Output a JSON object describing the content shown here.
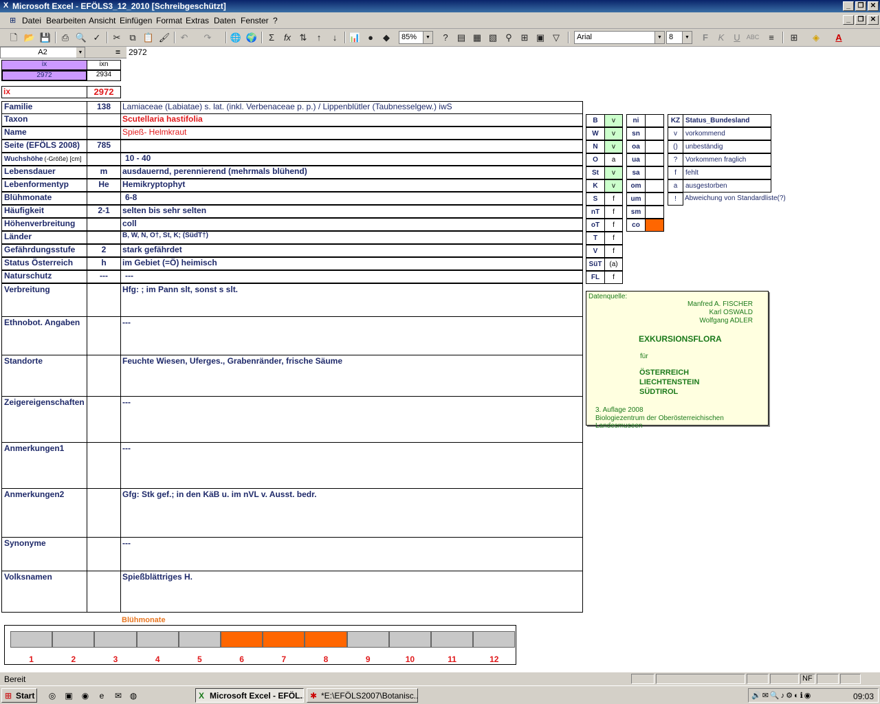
{
  "window": {
    "title": "Microsoft Excel - EFÖLS3_12_2010  [Schreibgeschützt]"
  },
  "menu": [
    "Datei",
    "Bearbeiten",
    "Ansicht",
    "Einfügen",
    "Format",
    "Extras",
    "Daten",
    "Fenster",
    "?"
  ],
  "toolbar": {
    "zoom": "85%",
    "font": "Arial",
    "size": "8"
  },
  "formula": {
    "cellref": "A2",
    "eq": "=",
    "value": "2972"
  },
  "top": {
    "ix_header": "ix",
    "ixn_header": "ixn",
    "ix_val": "2972",
    "ixn_val": "2934",
    "ix_label": "ix",
    "ix_big": "2972"
  },
  "rows": [
    {
      "label": "Familie",
      "mid": "138",
      "value": "Lamiaceae (Labiatae) s. lat. (inkl. Verbenaceae p. p.)  /  Lippenblütler (Taubnesselgew.) iwS"
    },
    {
      "label": "Taxon",
      "mid": "",
      "value": "Scutellaria hastifolia"
    },
    {
      "label": "Name",
      "mid": "",
      "value": "Spieß- Helmkraut"
    },
    {
      "label": "Seite (EFÖLS 2008)",
      "mid": "785",
      "value": ""
    },
    {
      "label": "Wuchshöhe",
      "label_small": "(-Größe) [cm]",
      "mid": "",
      "value": "10 - 40"
    },
    {
      "label": "Lebensdauer",
      "mid": "m",
      "value": "ausdauernd, perennierend (mehrmals blühend)"
    },
    {
      "label": "Lebenformentyp",
      "mid": "He",
      "value": "Hemikryptophyt"
    },
    {
      "label": "Blühmonate",
      "mid": "",
      "value": "6-8"
    },
    {
      "label": "Häufigkeit",
      "mid": "2-1",
      "value": "selten bis sehr selten"
    },
    {
      "label": "Höhenverbreitung",
      "mid": "",
      "value": "coll"
    },
    {
      "label": "Länder",
      "mid": "",
      "value": "B, W, N, O†, St, K; (SüdT†)"
    },
    {
      "label": "Gefährdungsstufe",
      "mid": "2",
      "value": "stark gefährdet"
    },
    {
      "label": "Status Österreich",
      "mid": "h",
      "value": "im Gebiet (=Ö) heimisch"
    },
    {
      "label": "Naturschutz",
      "mid": "---",
      "value": "---"
    }
  ],
  "big_rows": [
    {
      "label": "Verbreitung",
      "value": "Hfg: ; im Pann slt, sonst s slt."
    },
    {
      "label": "Ethnobot. Angaben",
      "value": "---"
    },
    {
      "label": "Standorte",
      "value": "Feuchte Wiesen, Uferges., Grabenränder, frische Säume"
    },
    {
      "label": "Zeigereigenschaften",
      "value": "---"
    },
    {
      "label": "Anmerkungen1",
      "value": "---"
    },
    {
      "label": "Anmerkungen2",
      "value": "Gfg:  Stk gef.; in den KäB u. im nVL v. Ausst. bedr."
    },
    {
      "label": "Synonyme",
      "value": "---"
    },
    {
      "label": "Volksnamen",
      "value": "Spießblättriges H."
    }
  ],
  "states": [
    {
      "k": "B",
      "v": "v"
    },
    {
      "k": "W",
      "v": "v"
    },
    {
      "k": "N",
      "v": "v"
    },
    {
      "k": "O",
      "v": "a"
    },
    {
      "k": "St",
      "v": "v"
    },
    {
      "k": "K",
      "v": "v"
    },
    {
      "k": "S",
      "v": "f"
    },
    {
      "k": "nT",
      "v": "f"
    },
    {
      "k": "oT",
      "v": "f"
    },
    {
      "k": "T",
      "v": "f"
    },
    {
      "k": "V",
      "v": "f"
    },
    {
      "k": "SüT",
      "v": "(a)"
    },
    {
      "k": "FL",
      "v": "f"
    }
  ],
  "zones": [
    {
      "k": "ni",
      "v": ""
    },
    {
      "k": "sn",
      "v": ""
    },
    {
      "k": "oa",
      "v": ""
    },
    {
      "k": "ua",
      "v": ""
    },
    {
      "k": "sa",
      "v": ""
    },
    {
      "k": "om",
      "v": ""
    },
    {
      "k": "um",
      "v": ""
    },
    {
      "k": "sm",
      "v": ""
    },
    {
      "k": "co",
      "v": ""
    }
  ],
  "legend": [
    {
      "k": "KZ",
      "v": "Status_Bundesland"
    },
    {
      "k": "v",
      "v": "vorkommend"
    },
    {
      "k": "()",
      "v": "unbeständig"
    },
    {
      "k": "?",
      "v": "Vorkommen fraglich"
    },
    {
      "k": "f",
      "v": "fehlt"
    },
    {
      "k": "a",
      "v": "ausgestorben"
    },
    {
      "k": "!",
      "v": "Abweichung von Standardliste(?)"
    }
  ],
  "source": {
    "head": "Datenquelle:",
    "authors": [
      "Manfred A. FISCHER",
      "Karl OSWALD",
      "Wolfgang ADLER"
    ],
    "title": "EXKURSIONSFLORA",
    "fuer": "für",
    "regions": [
      "ÖSTERREICH",
      "LIECHTENSTEIN",
      "SÜDTIROL"
    ],
    "edition": "3. Auflage 2008",
    "publisher": "Biologiezentrum der Oberösterreichischen Landesmuseen"
  },
  "chart_data": {
    "type": "bar",
    "title": "Blühmonate",
    "categories": [
      "1",
      "2",
      "3",
      "4",
      "5",
      "6",
      "7",
      "8",
      "9",
      "10",
      "11",
      "12"
    ],
    "values": [
      0,
      0,
      0,
      0,
      0,
      1,
      1,
      1,
      0,
      0,
      0,
      0
    ],
    "colors": {
      "on": "#ff6600",
      "off": "#c8c8c8"
    }
  },
  "status": {
    "text": "Bereit",
    "nf": "NF"
  },
  "taskbar": {
    "start": "Start",
    "tasks": [
      "Microsoft Excel - EFÖL...",
      "*E:\\EFÖLS2007\\Botanisc..."
    ],
    "clock": "09:03"
  }
}
